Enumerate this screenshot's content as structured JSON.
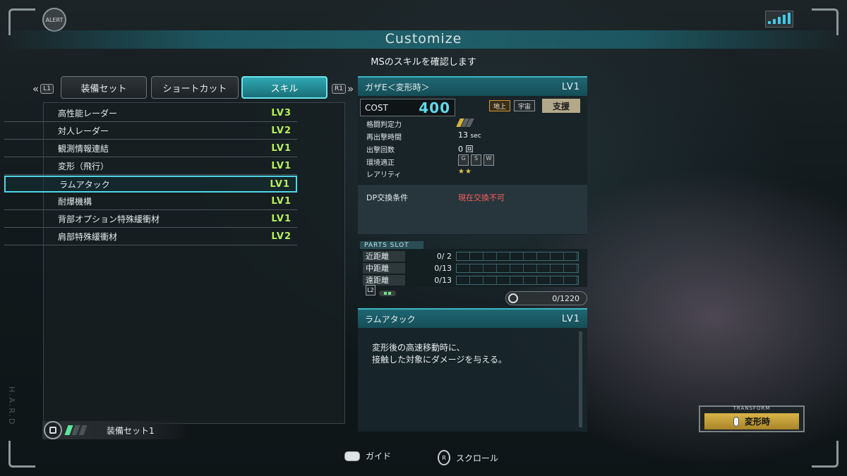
{
  "hud": {
    "alert": "ALERT",
    "signal_icon": "signal-bars-icon",
    "side_text": "H.A.R.D"
  },
  "header": {
    "title": "Customize",
    "subtitle": "MSのスキルを確認します"
  },
  "tabs": {
    "left_button": "L1",
    "right_button": "R1",
    "items": [
      {
        "label": "装備セット",
        "active": false
      },
      {
        "label": "ショートカット",
        "active": false
      },
      {
        "label": "スキル",
        "active": true
      }
    ]
  },
  "skills": [
    {
      "name": "高性能レーダー",
      "level": "LV3"
    },
    {
      "name": "対人レーダー",
      "level": "LV2"
    },
    {
      "name": "観測情報連結",
      "level": "LV1"
    },
    {
      "name": "変形（飛行）",
      "level": "LV1"
    },
    {
      "name": "ラムアタック",
      "level": "LV1",
      "selected": true
    },
    {
      "name": "耐爆機構",
      "level": "LV1"
    },
    {
      "name": "背部オプション特殊緩衝材",
      "level": "LV1"
    },
    {
      "name": "肩部特殊緩衝材",
      "level": "LV2"
    }
  ],
  "loadout": {
    "label": "装備セット1"
  },
  "unit": {
    "name": "ガザE＜変形時＞",
    "level": "LV1",
    "cost_label": "COST",
    "cost": "400",
    "terrain": [
      "地上",
      "宇宙"
    ],
    "role": "支援",
    "stats": [
      {
        "label": "格闘判定力",
        "value": ""
      },
      {
        "label": "再出撃時間",
        "value": "13",
        "unit": "sec"
      },
      {
        "label": "出撃回数",
        "value": "0 回"
      },
      {
        "label": "環境適正",
        "value": ""
      },
      {
        "label": "レアリティ",
        "value": "★★"
      }
    ],
    "env_codes": [
      "G",
      "S",
      "W"
    ],
    "dp_label": "DP交換条件",
    "dp_value": "現在交換不可"
  },
  "parts_slot": {
    "title": "PARTS SLOT",
    "rows": [
      {
        "label": "近距離",
        "value": "0/ 2"
      },
      {
        "label": "中距離",
        "value": "0/13"
      },
      {
        "label": "遠距離",
        "value": "0/13"
      }
    ],
    "l2": "L2",
    "capacity": "0/1220"
  },
  "skill_detail": {
    "name": "ラムアタック",
    "level": "LV1",
    "description": "変形後の高速移動時に、\n接触した対象にダメージを与える。"
  },
  "transform": {
    "label": "TRANSFORM",
    "state": "変形時"
  },
  "footer": {
    "guide": "ガイド",
    "scroll": "スクロール",
    "scroll_key": "R"
  }
}
